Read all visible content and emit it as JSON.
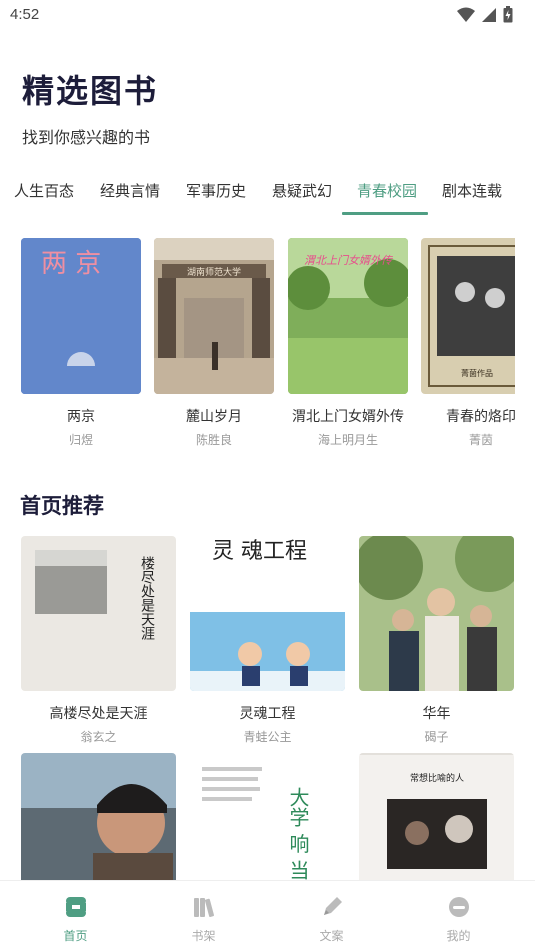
{
  "status": {
    "time": "4:52"
  },
  "header": {
    "title": "精选图书",
    "subtitle": "找到你感兴趣的书"
  },
  "tabs": [
    {
      "label": "人生百态"
    },
    {
      "label": "经典言情"
    },
    {
      "label": "军事历史"
    },
    {
      "label": "悬疑武幻"
    },
    {
      "label": "青春校园",
      "active": true
    },
    {
      "label": "剧本连载"
    }
  ],
  "carousel": [
    {
      "title": "两京",
      "author": "归煜",
      "cover_text": "两 京"
    },
    {
      "title": "麓山岁月",
      "author": "陈胜良",
      "cover_text": "湖南师范大学"
    },
    {
      "title": "渭北上门女婿外传",
      "author": "海上明月生",
      "cover_text": "渭北上门女婿外传"
    },
    {
      "title": "青春的烙印",
      "author": "菁茵",
      "cover_text": "菁菌作品"
    }
  ],
  "recommend": {
    "title": "首页推荐",
    "items": [
      {
        "title": "高楼尽处是天涯",
        "author": "翁玄之",
        "cover_text": "楼尽处是天涯"
      },
      {
        "title": "灵魂工程",
        "author": "青蛙公主",
        "cover_text": "灵 魂工程"
      },
      {
        "title": "华年",
        "author": "碣子"
      },
      {
        "title": "",
        "author": ""
      },
      {
        "title": "",
        "author": "",
        "cover_text": "大学 响 当当"
      },
      {
        "title": "",
        "author": "",
        "cover_text": "常想比喻的人"
      }
    ]
  },
  "nav": [
    {
      "label": "首页",
      "active": true,
      "icon": "home-icon"
    },
    {
      "label": "书架",
      "icon": "bookshelf-icon"
    },
    {
      "label": "文案",
      "icon": "pen-icon"
    },
    {
      "label": "我的",
      "icon": "profile-icon"
    }
  ],
  "colors": {
    "accent": "#4f9e83",
    "title": "#1d1d3a"
  }
}
